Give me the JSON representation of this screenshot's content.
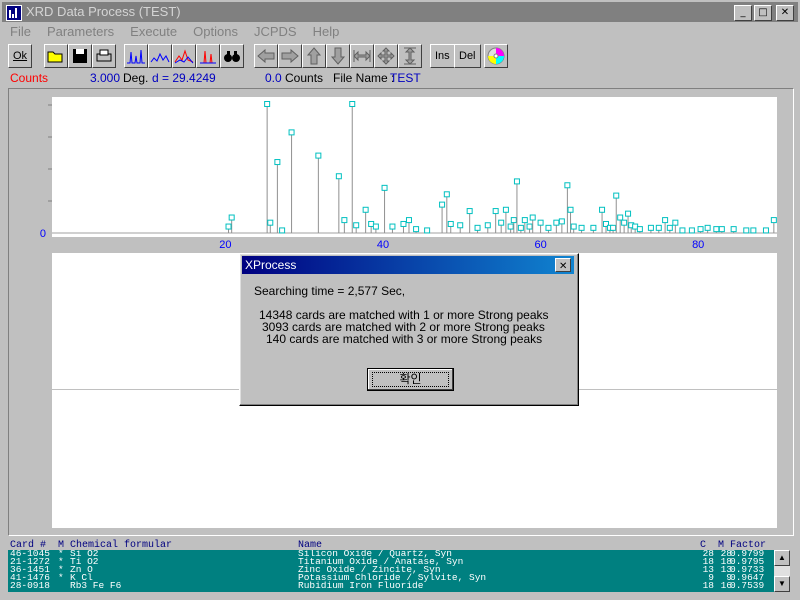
{
  "window": {
    "title": "XRD Data Process (TEST)"
  },
  "menu": [
    {
      "label": "File",
      "id": "file"
    },
    {
      "label": "Parameters",
      "id": "parameters"
    },
    {
      "label": "Execute",
      "id": "execute"
    },
    {
      "label": "Options",
      "id": "options"
    },
    {
      "label": "JCPDS",
      "id": "jcpds"
    },
    {
      "label": "Help",
      "id": "help"
    }
  ],
  "toolbar": {
    "ok_label": "Ok",
    "ins_label": "Ins",
    "del_label": "Del",
    "icons": [
      "open-icon",
      "save-icon",
      "print-icon",
      "spectrum-icon",
      "smooth-icon",
      "peak-icon",
      "compare-icon",
      "binoculars-icon",
      "arrow-left-icon",
      "arrow-right-icon",
      "arrow-up-icon",
      "arrow-down-icon",
      "expand-horizontal-icon",
      "expand-all-icon",
      "expand-vertical-icon",
      "disc-icon"
    ]
  },
  "status": {
    "mode": "Counts",
    "deg_value": "3.000",
    "deg_unit": "Deg.",
    "d_value": "d = 29.4249",
    "counts_value": "0.0",
    "counts_unit": "Counts",
    "file_label": "File Name :",
    "file_name": "TEST"
  },
  "chart_data": {
    "type": "line",
    "xlim": [
      -2,
      90
    ],
    "ylim": [
      0,
      100
    ],
    "x_ticks": [
      20,
      40,
      60,
      80
    ],
    "y_ticks": [
      0
    ],
    "grid": false,
    "peaks": [
      {
        "x": 20.8,
        "y": 12
      },
      {
        "x": 20.4,
        "y": 5
      },
      {
        "x": 25.3,
        "y": 100
      },
      {
        "x": 25.7,
        "y": 8
      },
      {
        "x": 26.6,
        "y": 55
      },
      {
        "x": 27.2,
        "y": 2
      },
      {
        "x": 28.4,
        "y": 78
      },
      {
        "x": 31.8,
        "y": 60
      },
      {
        "x": 34.4,
        "y": 44
      },
      {
        "x": 35.1,
        "y": 10
      },
      {
        "x": 36.1,
        "y": 100
      },
      {
        "x": 36.6,
        "y": 6
      },
      {
        "x": 37.8,
        "y": 18
      },
      {
        "x": 38.5,
        "y": 7
      },
      {
        "x": 39.1,
        "y": 5
      },
      {
        "x": 40.2,
        "y": 35
      },
      {
        "x": 41.2,
        "y": 5
      },
      {
        "x": 42.6,
        "y": 7
      },
      {
        "x": 43.3,
        "y": 10
      },
      {
        "x": 44.2,
        "y": 3
      },
      {
        "x": 45.6,
        "y": 2
      },
      {
        "x": 47.5,
        "y": 22
      },
      {
        "x": 48.1,
        "y": 30
      },
      {
        "x": 48.6,
        "y": 7
      },
      {
        "x": 49.8,
        "y": 6
      },
      {
        "x": 51.0,
        "y": 17
      },
      {
        "x": 52.0,
        "y": 4
      },
      {
        "x": 53.3,
        "y": 6
      },
      {
        "x": 54.3,
        "y": 17
      },
      {
        "x": 55.0,
        "y": 8
      },
      {
        "x": 55.6,
        "y": 18
      },
      {
        "x": 56.2,
        "y": 5
      },
      {
        "x": 56.6,
        "y": 10
      },
      {
        "x": 57.0,
        "y": 40
      },
      {
        "x": 57.5,
        "y": 4
      },
      {
        "x": 58.0,
        "y": 10
      },
      {
        "x": 58.6,
        "y": 5
      },
      {
        "x": 59.0,
        "y": 12
      },
      {
        "x": 60.0,
        "y": 8
      },
      {
        "x": 61.0,
        "y": 4
      },
      {
        "x": 62.0,
        "y": 8
      },
      {
        "x": 62.7,
        "y": 9
      },
      {
        "x": 63.4,
        "y": 37
      },
      {
        "x": 63.8,
        "y": 18
      },
      {
        "x": 64.2,
        "y": 5
      },
      {
        "x": 65.2,
        "y": 4
      },
      {
        "x": 66.7,
        "y": 4
      },
      {
        "x": 67.8,
        "y": 18
      },
      {
        "x": 68.3,
        "y": 7
      },
      {
        "x": 68.8,
        "y": 4
      },
      {
        "x": 69.2,
        "y": 4
      },
      {
        "x": 69.6,
        "y": 29
      },
      {
        "x": 70.1,
        "y": 12
      },
      {
        "x": 70.6,
        "y": 8
      },
      {
        "x": 71.1,
        "y": 15
      },
      {
        "x": 71.5,
        "y": 6
      },
      {
        "x": 72.0,
        "y": 5
      },
      {
        "x": 72.6,
        "y": 3
      },
      {
        "x": 74.0,
        "y": 4
      },
      {
        "x": 75.0,
        "y": 4
      },
      {
        "x": 75.8,
        "y": 10
      },
      {
        "x": 76.4,
        "y": 4
      },
      {
        "x": 77.1,
        "y": 8
      },
      {
        "x": 78.0,
        "y": 2
      },
      {
        "x": 79.2,
        "y": 2
      },
      {
        "x": 80.3,
        "y": 3
      },
      {
        "x": 81.2,
        "y": 4
      },
      {
        "x": 82.3,
        "y": 3
      },
      {
        "x": 83.0,
        "y": 3
      },
      {
        "x": 84.5,
        "y": 3
      },
      {
        "x": 86.1,
        "y": 2
      },
      {
        "x": 87.0,
        "y": 2
      },
      {
        "x": 88.6,
        "y": 2
      },
      {
        "x": 89.6,
        "y": 10
      }
    ]
  },
  "dialog": {
    "title": "XProcess",
    "time_line": "Searching time = 2,577 Sec,",
    "line1": "14348 cards are matched with 1 or more Strong peaks",
    "line2": "3093 cards are matched with 2 or more Strong peaks",
    "line3": "140 cards are matched with 3 or more Strong peaks",
    "ok_label": "확인"
  },
  "cards": {
    "headers": {
      "card": "Card #",
      "m": "M",
      "formula": "Chemical formular",
      "name": "Name",
      "c": "C",
      "mm": "M",
      "factor": "Factor"
    },
    "rows": [
      {
        "card": "46-1045",
        "m": "*",
        "formula": "Si O2",
        "name": "Silicon Oxide / Quartz, Syn",
        "c": "28",
        "mm": "28",
        "factor": "0.9799"
      },
      {
        "card": "21-1272",
        "m": "*",
        "formula": "Ti O2",
        "name": "Titanium Oxide / Anatase, Syn",
        "c": "18",
        "mm": "18",
        "factor": "0.9795"
      },
      {
        "card": "36-1451",
        "m": "*",
        "formula": "Zn O",
        "name": "Zinc Oxide / Zincite, Syn",
        "c": "13",
        "mm": "13",
        "factor": "0.9733"
      },
      {
        "card": "41-1476",
        "m": "*",
        "formula": "K Cl",
        "name": "Potassium Chloride / Sylvite, Syn",
        "c": "9",
        "mm": "9",
        "factor": "0.9647"
      },
      {
        "card": "28-0918",
        "m": "",
        "formula": "Rb3 Fe F6",
        "name": "Rubidium Iron Fluoride",
        "c": "18",
        "mm": "16",
        "factor": "0.7539"
      }
    ]
  }
}
